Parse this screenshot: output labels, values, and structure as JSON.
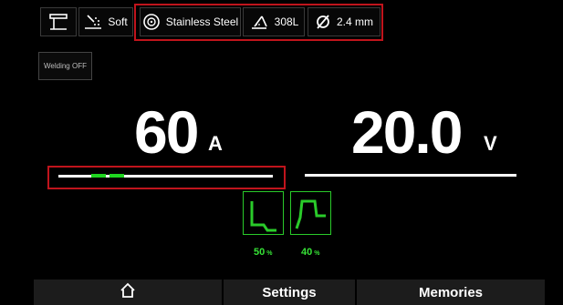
{
  "top_bar": {
    "process_icon": "welding-process-icon",
    "arc_icon": "arc-character-icon",
    "arc_label": "Soft",
    "material_icon": "material-spool-icon",
    "material_label": "Stainless Steel",
    "wire_icon": "filler-wire-icon",
    "wire_label": "308L",
    "diameter_icon": "diameter-icon",
    "diameter_label": "2.4 mm"
  },
  "welding_state": "Welding OFF",
  "current": {
    "value": "60",
    "unit": "A"
  },
  "voltage": {
    "value": "20.0",
    "unit": "V"
  },
  "modes": [
    {
      "icon": "pulse-down-slope-icon",
      "percent": "50",
      "unit": "%"
    },
    {
      "icon": "pulse-up-slope-icon",
      "percent": "40",
      "unit": "%"
    }
  ],
  "nav": {
    "home_icon": "home-icon",
    "settings_label": "Settings",
    "memories_label": "Memories"
  },
  "colors": {
    "accent_green": "#1fd620",
    "highlight_red": "#c0141c",
    "background": "#000000"
  }
}
